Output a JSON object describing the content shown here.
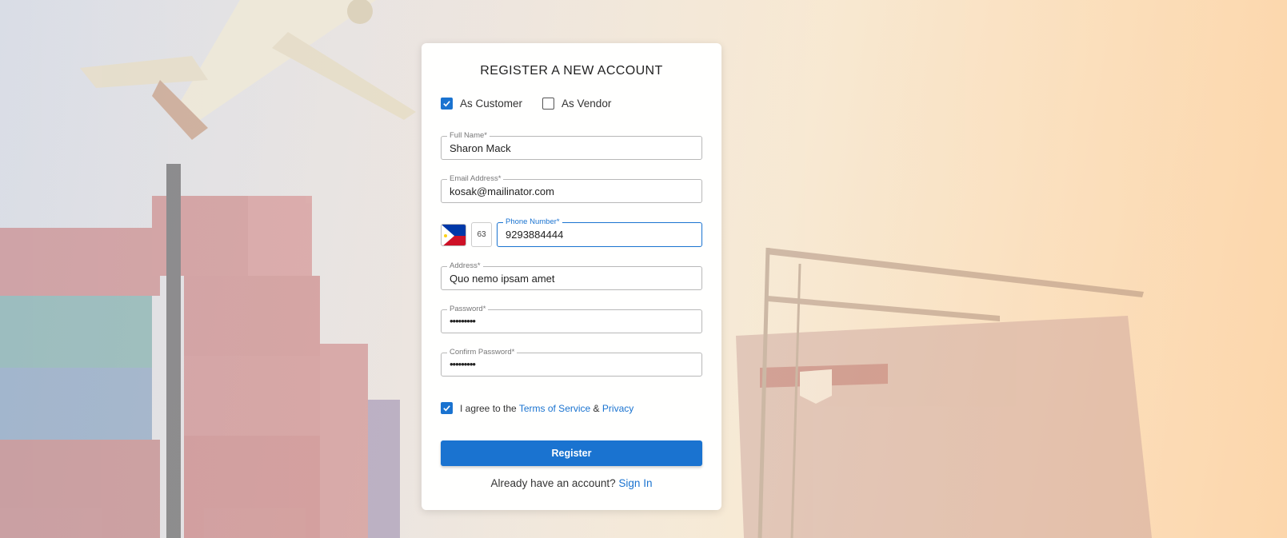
{
  "form": {
    "title": "REGISTER A NEW ACCOUNT",
    "roles": [
      {
        "label": "As Customer",
        "checked": true
      },
      {
        "label": "As Vendor",
        "checked": false
      }
    ],
    "full_name": {
      "label": "Full Name*",
      "value": "Sharon Mack"
    },
    "email": {
      "label": "Email Address*",
      "value": "kosak@mailinator.com"
    },
    "phone": {
      "country_code": "63",
      "label": "Phone Number*",
      "value": "9293884444",
      "flag_icon": "philippines-flag-icon"
    },
    "address": {
      "label": "Address*",
      "value": "Quo nemo ipsam amet"
    },
    "password": {
      "label": "Password*",
      "value": "•••••••••"
    },
    "confirm_password": {
      "label": "Confirm Password*",
      "value": "•••••••••"
    },
    "agreement": {
      "checked": true,
      "prefix": "I agree to the",
      "terms_link": "Terms of Service",
      "ampersand": "&",
      "privacy_link": "Privacy"
    },
    "register_label": "Register",
    "signin_prompt": "Already have an account?",
    "signin_link": "Sign In"
  },
  "colors": {
    "accent": "#1a73d0"
  }
}
